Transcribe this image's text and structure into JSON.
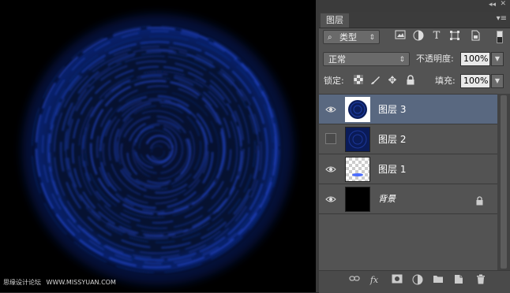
{
  "watermark": {
    "site_cn": "思缘设计论坛",
    "site_url": "WWW.MISSYUAN.COM"
  },
  "panel": {
    "tab_label": "图层",
    "collapse_icon": "double-chevron-icon",
    "menu_icon": "panel-menu-icon",
    "filter": {
      "kind_label": "类型",
      "icons": [
        "image-filter-icon",
        "adjustment-filter-icon",
        "type-filter-icon",
        "shape-filter-icon",
        "smart-object-filter-icon"
      ]
    },
    "blend_mode": "正常",
    "opacity_label": "不透明度:",
    "opacity_value": "100%",
    "lock_label": "锁定:",
    "fill_label": "填充:",
    "fill_value": "100%",
    "lock_icons": [
      "lock-transparent-icon",
      "lock-brush-icon",
      "lock-move-icon",
      "lock-all-icon"
    ],
    "layers": [
      {
        "name": "图层 3",
        "visible": true,
        "selected": true
      },
      {
        "name": "图层 2",
        "visible": false,
        "selected": false
      },
      {
        "name": "图层 1",
        "visible": true,
        "selected": false
      },
      {
        "name": "背景",
        "visible": true,
        "selected": false,
        "locked": true
      }
    ],
    "bottom_icons": [
      "link-icon",
      "fx-icon",
      "mask-icon",
      "adjustment-icon",
      "folder-icon",
      "new-layer-icon",
      "trash-icon"
    ],
    "fx_label": "fx"
  },
  "colors": {
    "spiral_blue": "#1f44c8",
    "selection": "#596880"
  }
}
